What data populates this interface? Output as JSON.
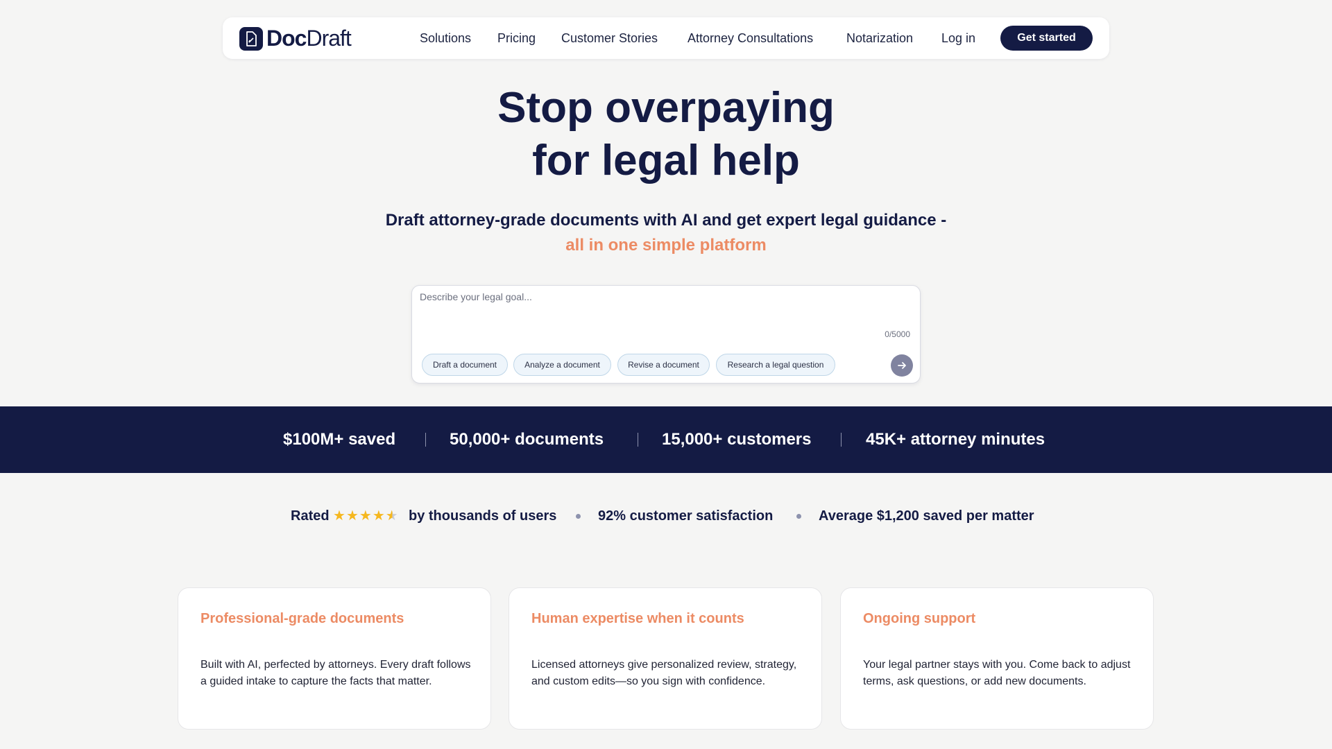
{
  "brand": {
    "name_bold": "Doc",
    "name_thin": "Draft"
  },
  "nav": {
    "links": [
      "Solutions",
      "Pricing",
      "Customer Stories",
      "Attorney Consultations",
      "Notarization",
      "Log in"
    ],
    "cta": "Get started"
  },
  "hero": {
    "title_line1": "Stop overpaying",
    "title_line2": "for legal help",
    "subtitle": "Draft attorney-grade documents with AI and get expert legal guidance -",
    "accent": "all in one simple platform"
  },
  "prompt": {
    "placeholder": "Describe your legal goal...",
    "value": "",
    "counter": "0/5000",
    "chips": [
      "Draft a document",
      "Analyze a document",
      "Revise a document",
      "Research a legal question"
    ]
  },
  "stats": [
    "$100M+ saved",
    "50,000+ documents",
    "15,000+ customers",
    "45K+ attorney minutes"
  ],
  "social_proof": {
    "rated_prefix": "Rated",
    "rating_stars": 4.5,
    "rated_suffix": "by thousands of users",
    "satisfaction": "92% customer satisfaction",
    "savings": "Average $1,200 saved per matter"
  },
  "features": [
    {
      "title": "Professional-grade documents",
      "body": "Built with AI, perfected by attorneys. Every draft follows a guided intake to capture the facts that matter."
    },
    {
      "title": "Human expertise when it counts",
      "body": "Licensed attorneys give personalized review, strategy, and custom edits—so you sign with confidence."
    },
    {
      "title": "Ongoing support",
      "body": "Your legal partner stays with you. Come back to adjust terms, ask questions, or add new documents."
    }
  ],
  "colors": {
    "navy": "#141b44",
    "accent": "#ec8b64",
    "star": "#f5b71f",
    "page_bg": "#f5f5f4"
  },
  "icons": {
    "logo": "document-icon",
    "send": "arrow-right-icon",
    "star": "star-icon"
  }
}
